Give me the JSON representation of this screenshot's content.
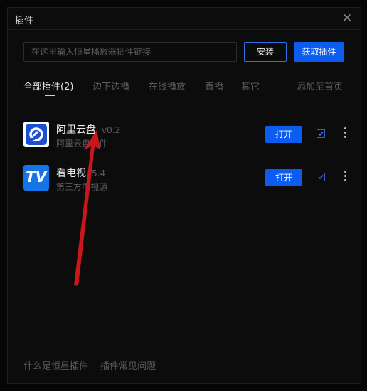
{
  "window": {
    "title": "插件",
    "close_glyph": "✕"
  },
  "toolbar": {
    "search_placeholder": "在这里输入恒星播放器插件链接",
    "install_label": "安装",
    "get_plugin_label": "获取插件"
  },
  "tabs": [
    {
      "label": "全部插件(2)",
      "active": true
    },
    {
      "label": "边下边播",
      "active": false
    },
    {
      "label": "在线播放",
      "active": false
    },
    {
      "label": "直播",
      "active": false
    },
    {
      "label": "其它",
      "active": false
    }
  ],
  "add_to_home_label": "添加至首页",
  "plugins": [
    {
      "name": "阿里云盘",
      "version": "v0.2",
      "desc": "阿里云盘插件",
      "open_label": "打开",
      "checked": true,
      "icon": "aliyundrive-icon"
    },
    {
      "name": "看电视",
      "version": "5.4",
      "desc": "第三方电视源",
      "open_label": "打开",
      "checked": true,
      "icon": "tv-icon",
      "icon_text": "TV"
    }
  ],
  "footer": {
    "what_is": "什么是恒星插件",
    "faq": "插件常见问题"
  },
  "colors": {
    "accent": "#0d5cf0",
    "annotation_arrow": "#c9171b"
  }
}
